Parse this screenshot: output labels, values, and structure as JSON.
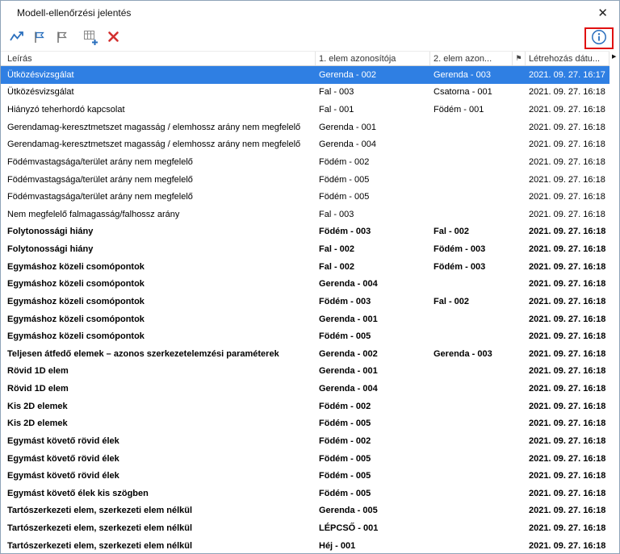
{
  "window": {
    "title": "Modell-ellenőrzési jelentés",
    "close": "✕"
  },
  "toolbar": {
    "buttons": [
      {
        "name": "show-in-model",
        "icon": "zigzag-arrow-icon"
      },
      {
        "name": "add-flag",
        "icon": "flag-icon"
      },
      {
        "name": "remove-flag",
        "icon": "flag-icon"
      },
      {
        "name": "add-report-item",
        "icon": "table-plus-icon"
      },
      {
        "name": "delete",
        "icon": "red-x-icon"
      },
      {
        "name": "info",
        "icon": "info-circle-icon",
        "highlighted": true
      }
    ]
  },
  "colors": {
    "selection_blue": "#2F7FE3",
    "icon_blue": "#2A6FBD",
    "delete_red": "#D3302F",
    "annotation_red": "#E01010"
  },
  "table": {
    "scroll_arrow": "▶",
    "columns": [
      {
        "key": "desc",
        "label": "Leírás"
      },
      {
        "key": "e1",
        "label": "1. elem azonosítója"
      },
      {
        "key": "e2",
        "label": "2. elem azon..."
      },
      {
        "key": "flag",
        "label": "⚑"
      },
      {
        "key": "date",
        "label": "Létrehozás dátu..."
      }
    ],
    "rows": [
      {
        "desc": "Ütközésvizsgálat",
        "e1": "Gerenda - 002",
        "e2": "Gerenda - 003",
        "date": "2021. 09. 27. 16:17",
        "bold": false,
        "selected": true
      },
      {
        "desc": "Ütközésvizsgálat",
        "e1": "Fal - 003",
        "e2": "Csatorna - 001",
        "date": "2021. 09. 27. 16:18",
        "bold": false,
        "selected": false
      },
      {
        "desc": "Hiányzó teherhordó kapcsolat",
        "e1": "Fal - 001",
        "e2": "Födém - 001",
        "date": "2021. 09. 27. 16:18",
        "bold": false,
        "selected": false
      },
      {
        "desc": "Gerendamag-keresztmetszet magasság / elemhossz arány nem megfelelő",
        "e1": "Gerenda - 001",
        "e2": "",
        "date": "2021. 09. 27. 16:18",
        "bold": false,
        "selected": false
      },
      {
        "desc": "Gerendamag-keresztmetszet magasság / elemhossz arány nem megfelelő",
        "e1": "Gerenda - 004",
        "e2": "",
        "date": "2021. 09. 27. 16:18",
        "bold": false,
        "selected": false
      },
      {
        "desc": "Födémvastagsága/terület arány nem megfelelő",
        "e1": "Födém - 002",
        "e2": "",
        "date": "2021. 09. 27. 16:18",
        "bold": false,
        "selected": false
      },
      {
        "desc": "Födémvastagsága/terület arány nem megfelelő",
        "e1": "Födém - 005",
        "e2": "",
        "date": "2021. 09. 27. 16:18",
        "bold": false,
        "selected": false
      },
      {
        "desc": "Födémvastagsága/terület arány nem megfelelő",
        "e1": "Födém - 005",
        "e2": "",
        "date": "2021. 09. 27. 16:18",
        "bold": false,
        "selected": false
      },
      {
        "desc": "Nem megfelelő falmagasság/falhossz arány",
        "e1": "Fal - 003",
        "e2": "",
        "date": "2021. 09. 27. 16:18",
        "bold": false,
        "selected": false
      },
      {
        "desc": "Folytonossági hiány",
        "e1": "Födém - 003",
        "e2": "Fal - 002",
        "date": "2021. 09. 27. 16:18",
        "bold": true,
        "selected": false
      },
      {
        "desc": "Folytonossági hiány",
        "e1": "Fal - 002",
        "e2": "Födém - 003",
        "date": "2021. 09. 27. 16:18",
        "bold": true,
        "selected": false
      },
      {
        "desc": "Egymáshoz közeli csomópontok",
        "e1": "Fal - 002",
        "e2": "Födém - 003",
        "date": "2021. 09. 27. 16:18",
        "bold": true,
        "selected": false
      },
      {
        "desc": "Egymáshoz közeli csomópontok",
        "e1": "Gerenda - 004",
        "e2": "",
        "date": "2021. 09. 27. 16:18",
        "bold": true,
        "selected": false
      },
      {
        "desc": "Egymáshoz közeli csomópontok",
        "e1": "Födém - 003",
        "e2": "Fal - 002",
        "date": "2021. 09. 27. 16:18",
        "bold": true,
        "selected": false
      },
      {
        "desc": "Egymáshoz közeli csomópontok",
        "e1": "Gerenda - 001",
        "e2": "",
        "date": "2021. 09. 27. 16:18",
        "bold": true,
        "selected": false
      },
      {
        "desc": "Egymáshoz közeli csomópontok",
        "e1": "Födém - 005",
        "e2": "",
        "date": "2021. 09. 27. 16:18",
        "bold": true,
        "selected": false
      },
      {
        "desc": "Teljesen átfedő elemek – azonos szerkezetelemzési paraméterek",
        "e1": "Gerenda - 002",
        "e2": "Gerenda - 003",
        "date": "2021. 09. 27. 16:18",
        "bold": true,
        "selected": false
      },
      {
        "desc": "Rövid 1D elem",
        "e1": "Gerenda - 001",
        "e2": "",
        "date": "2021. 09. 27. 16:18",
        "bold": true,
        "selected": false
      },
      {
        "desc": "Rövid 1D elem",
        "e1": "Gerenda - 004",
        "e2": "",
        "date": "2021. 09. 27. 16:18",
        "bold": true,
        "selected": false
      },
      {
        "desc": "Kis 2D elemek",
        "e1": "Födém - 002",
        "e2": "",
        "date": "2021. 09. 27. 16:18",
        "bold": true,
        "selected": false
      },
      {
        "desc": "Kis 2D elemek",
        "e1": "Födém - 005",
        "e2": "",
        "date": "2021. 09. 27. 16:18",
        "bold": true,
        "selected": false
      },
      {
        "desc": "Egymást követő rövid élek",
        "e1": "Födém - 002",
        "e2": "",
        "date": "2021. 09. 27. 16:18",
        "bold": true,
        "selected": false
      },
      {
        "desc": "Egymást követő rövid élek",
        "e1": "Födém - 005",
        "e2": "",
        "date": "2021. 09. 27. 16:18",
        "bold": true,
        "selected": false
      },
      {
        "desc": "Egymást követő rövid élek",
        "e1": "Födém - 005",
        "e2": "",
        "date": "2021. 09. 27. 16:18",
        "bold": true,
        "selected": false
      },
      {
        "desc": "Egymást követő élek kis szögben",
        "e1": "Födém - 005",
        "e2": "",
        "date": "2021. 09. 27. 16:18",
        "bold": true,
        "selected": false
      },
      {
        "desc": "Tartószerkezeti elem, szerkezeti elem nélkül",
        "e1": "Gerenda - 005",
        "e2": "",
        "date": "2021. 09. 27. 16:18",
        "bold": true,
        "selected": false
      },
      {
        "desc": "Tartószerkezeti elem, szerkezeti elem nélkül",
        "e1": "LÉPCSŐ - 001",
        "e2": "",
        "date": "2021. 09. 27. 16:18",
        "bold": true,
        "selected": false
      },
      {
        "desc": "Tartószerkezeti elem, szerkezeti elem nélkül",
        "e1": "Héj - 001",
        "e2": "",
        "date": "2021. 09. 27. 16:18",
        "bold": true,
        "selected": false
      }
    ]
  }
}
